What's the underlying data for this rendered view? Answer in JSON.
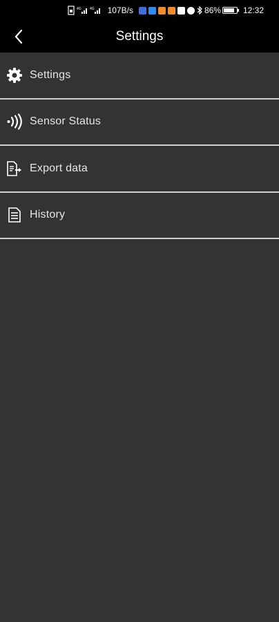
{
  "status_bar": {
    "network_speed": "107B/s",
    "battery_percent_text": "86%",
    "battery_level": 0.86,
    "time": "12:32",
    "app_icon_colors": [
      "#3b6fe0",
      "#2d8cf0",
      "#f28c28",
      "#f28c28",
      "#ffffff",
      "#ffffff"
    ]
  },
  "app_bar": {
    "title": "Settings",
    "back_icon": "chevron-left-icon"
  },
  "menu": {
    "items": [
      {
        "label": "Settings",
        "icon": "gear-icon"
      },
      {
        "label": "Sensor Status",
        "icon": "signal-waves-icon"
      },
      {
        "label": "Export data",
        "icon": "export-document-icon"
      },
      {
        "label": "History",
        "icon": "document-list-icon"
      }
    ]
  },
  "colors": {
    "background": "#333333",
    "bar": "#000000",
    "divider": "#d0d0d0",
    "text": "#e6e6e6"
  }
}
